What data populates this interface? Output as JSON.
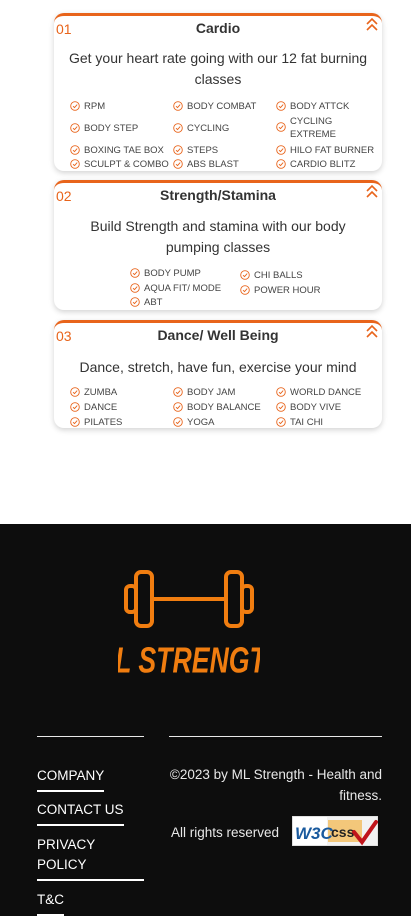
{
  "cards": [
    {
      "num": "01",
      "title": "Cardio",
      "description": "Get your heart rate going with our 12 fat burning classes",
      "items": [
        "RPM",
        "BODY COMBAT",
        "BODY ATTCK",
        "BODY STEP",
        "CYCLING",
        "CYCLING EXTREME",
        "BOXING TAE BOX",
        "STEPS",
        "HILO FAT BURNER",
        "SCULPT & COMBO",
        "ABS BLAST",
        "CARDIO BLITZ"
      ]
    },
    {
      "num": "02",
      "title": "Strength/Stamina",
      "description": "Build Strength and stamina with our body pumping classes",
      "items": [
        "BODY PUMP",
        "AQUA FIT/ MODE",
        "ABT",
        "CHI BALLS",
        "POWER HOUR"
      ]
    },
    {
      "num": "03",
      "title": "Dance/ Well Being",
      "description": "Dance, stretch, have fun, exercise your mind",
      "items": [
        "ZUMBA",
        "BODY JAM",
        "WORLD DANCE",
        "DANCE",
        "BODY BALANCE",
        "BODY VIVE",
        "PILATES",
        "YOGA",
        "TAI CHI"
      ]
    }
  ],
  "footer": {
    "logo_text": "ML STRENGTH",
    "links": [
      "COMPANY",
      "CONTACT US",
      "PRIVACY POLICY",
      "T&C"
    ],
    "copyright": "©2023 by ML Strength - Health and fitness.",
    "rights": "All rights reserved",
    "badge_text_w3c": "W3C",
    "badge_text_css": "css"
  },
  "colors": {
    "accent": "#e8641b",
    "footer_bg": "#0d0d0d",
    "logo": "#f07d10"
  },
  "icons": {
    "collapse": "chevron-double-up-icon",
    "check": "check-circle-icon"
  }
}
